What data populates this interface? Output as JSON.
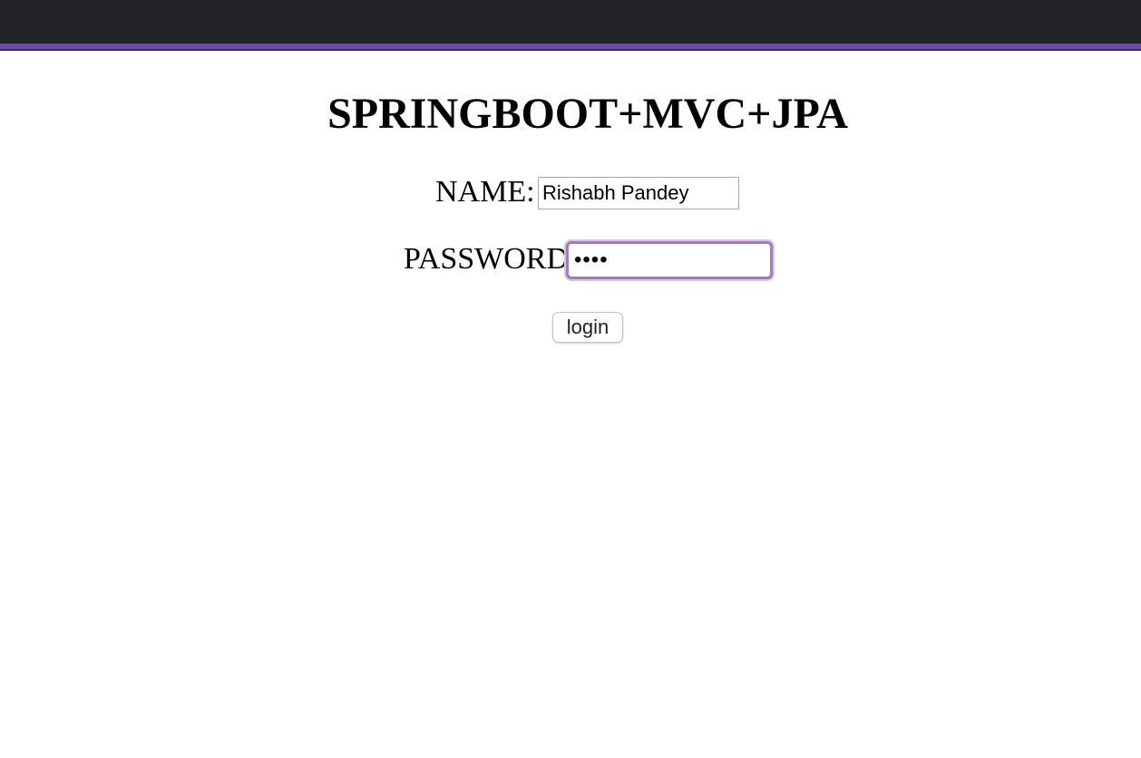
{
  "header": {
    "bar_color": "#222327",
    "accent_color": "#6b4aa0"
  },
  "form": {
    "title": "SPRINGBOOT+MVC+JPA",
    "name_label": "NAME:",
    "name_value": "Rishabh Pandey",
    "password_label": "PASSWORD:",
    "password_value": "••••",
    "password_focused": true,
    "submit_label": "login"
  }
}
